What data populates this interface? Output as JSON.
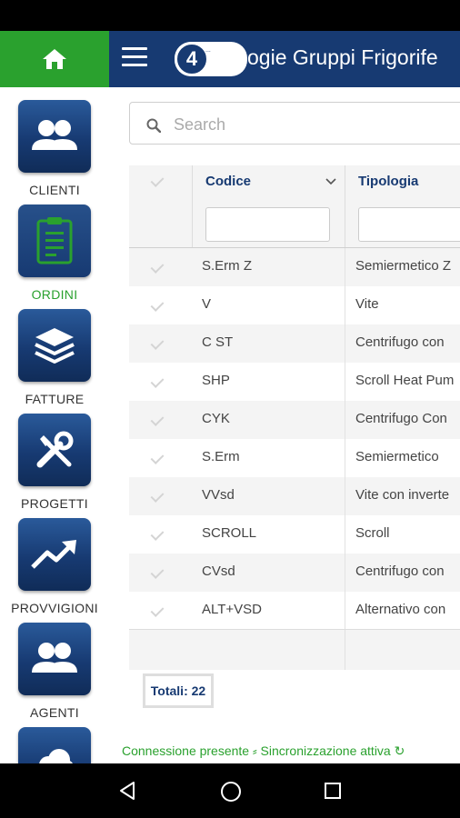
{
  "header": {
    "home_icon": "home-icon",
    "menu_icon": "hamburger-menu-icon",
    "logo_text": "4",
    "logo_small": "...",
    "title": "ogie Gruppi Frigorife"
  },
  "sidebar": {
    "items": [
      {
        "label": "CLIENTI",
        "icon": "people-icon",
        "active": false
      },
      {
        "label": "ORDINI",
        "icon": "clipboard-icon",
        "active": true
      },
      {
        "label": "FATTURE",
        "icon": "layers-icon",
        "active": false
      },
      {
        "label": "PROGETTI",
        "icon": "tools-icon",
        "active": false
      },
      {
        "label": "PROVVIGIONI",
        "icon": "trend-up-icon",
        "active": false
      },
      {
        "label": "AGENTI",
        "icon": "people-icon",
        "active": false
      },
      {
        "label": "",
        "icon": "cloud-icon",
        "active": false
      }
    ]
  },
  "search": {
    "placeholder": "Search",
    "value": ""
  },
  "grid": {
    "columns": [
      {
        "label": "Codice",
        "sortable": true
      },
      {
        "label": "Tipologia",
        "sortable": false
      }
    ],
    "rows": [
      {
        "codice": "S.Erm Z",
        "tipologia": "Semiermetico Z"
      },
      {
        "codice": "V",
        "tipologia": "Vite"
      },
      {
        "codice": "C ST",
        "tipologia": "Centrifugo con"
      },
      {
        "codice": "SHP",
        "tipologia": "Scroll Heat Pum"
      },
      {
        "codice": "CYK",
        "tipologia": "Centrifugo Con"
      },
      {
        "codice": "S.Erm",
        "tipologia": "Semiermetico"
      },
      {
        "codice": "VVsd",
        "tipologia": "Vite con inverte"
      },
      {
        "codice": "SCROLL",
        "tipologia": "Scroll"
      },
      {
        "codice": "CVsd",
        "tipologia": "Centrifugo con"
      },
      {
        "codice": "ALT+VSD",
        "tipologia": "Alternativo con"
      }
    ],
    "totals": "Totali: 22"
  },
  "status": {
    "text": "Connessione presente ⸗ Sincronizzazione attiva ↻",
    "color": "#2aa12e"
  },
  "colors": {
    "brand_blue": "#173a72",
    "brand_green": "#2aa12e"
  }
}
